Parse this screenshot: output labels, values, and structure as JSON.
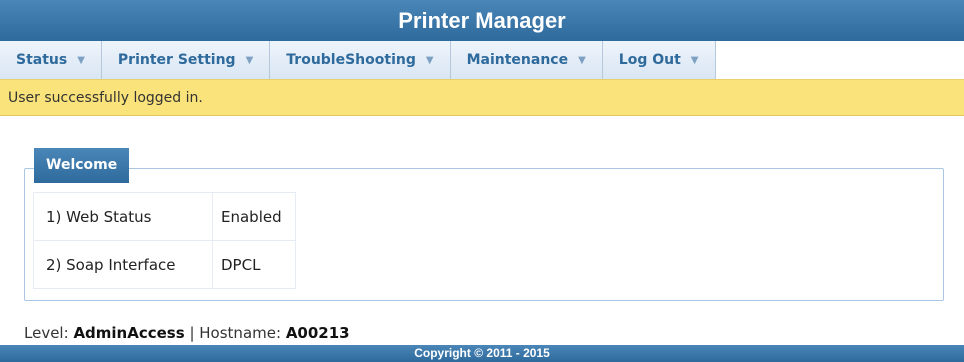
{
  "app": {
    "title": "Printer Manager"
  },
  "nav": {
    "items": [
      {
        "label": "Status"
      },
      {
        "label": "Printer Setting"
      },
      {
        "label": "TroubleShooting"
      },
      {
        "label": "Maintenance"
      },
      {
        "label": "Log Out"
      }
    ],
    "caret_icon": "chevron-down-icon"
  },
  "status_message": "User successfully logged in.",
  "welcome": {
    "legend": "Welcome",
    "rows": [
      {
        "key": "1) Web Status",
        "value": "Enabled"
      },
      {
        "key": "2) Soap Interface",
        "value": "DPCL"
      }
    ]
  },
  "footer": {
    "level_label": "Level:",
    "level_value": "AdminAccess",
    "separator": "|",
    "hostname_label": "Hostname:",
    "hostname_value": "A00213",
    "copyright": "Copyright © 2011 - 2015"
  },
  "colors": {
    "header_blue": "#2f6a9c",
    "status_yellow": "#fae37a",
    "nav_text": "#2f6a9c"
  }
}
